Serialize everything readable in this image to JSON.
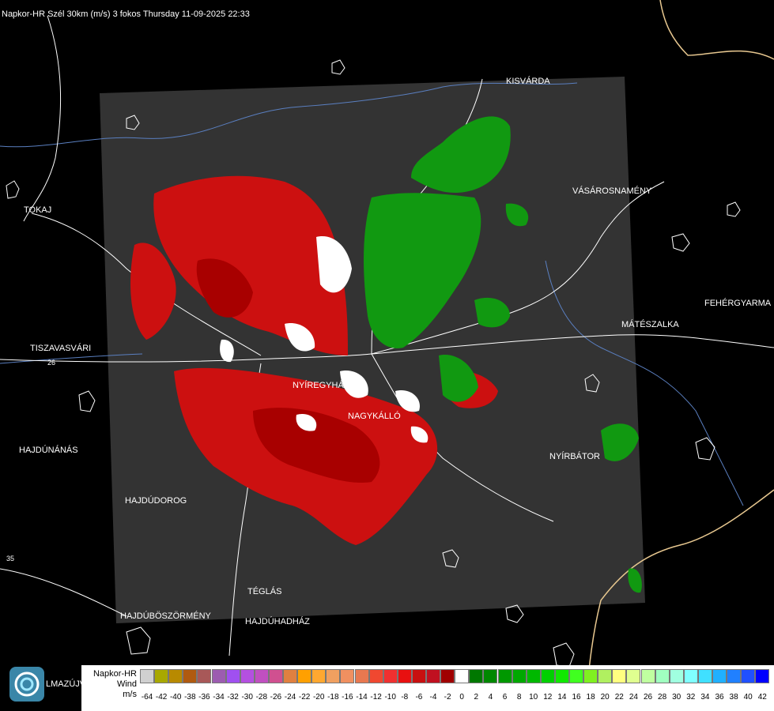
{
  "title": "Napkor-HR Szél 30km (m/s) 3 fokos Thursday 11-09-2025 22:33",
  "cities": [
    {
      "id": "kisvarda",
      "name": "KISVÁRDA"
    },
    {
      "id": "vasarosnameny",
      "name": "VÁSÁROSNAMÉNY"
    },
    {
      "id": "tokaj",
      "name": "TOKAJ"
    },
    {
      "id": "fehergyarmat",
      "name": "FEHÉRGYARMA"
    },
    {
      "id": "mateszalka",
      "name": "MÁTÉSZALKA"
    },
    {
      "id": "tiszavasvari",
      "name": "TISZAVASVÁRI"
    },
    {
      "id": "nyiregyhaza",
      "name": "NYÍREGYHÁZA"
    },
    {
      "id": "nagykallo",
      "name": "NAGYKÁLLÓ"
    },
    {
      "id": "hajdunanas",
      "name": "HAJDÚNÁNÁS"
    },
    {
      "id": "nyirbator",
      "name": "NYÍRBÁTOR"
    },
    {
      "id": "hajdudorog",
      "name": "HAJDÚDOROG"
    },
    {
      "id": "teglas",
      "name": "TÉGLÁS"
    },
    {
      "id": "hajduboszormeny",
      "name": "HAJDÚBÖSZÖRMÉNY"
    },
    {
      "id": "hajduhadhaz",
      "name": "HAJDÚHADHÁZ"
    }
  ],
  "road_labels": [
    "26",
    "35"
  ],
  "logo_text": "LMAZÚJVÁR",
  "legend": {
    "name_line1": "Napkor-HR",
    "name_line2": "Wind",
    "unit": "m/s",
    "ticks": [
      "-64",
      "-42",
      "-40",
      "-38",
      "-36",
      "-34",
      "-32",
      "-30",
      "-28",
      "-26",
      "-24",
      "-22",
      "-20",
      "-18",
      "-16",
      "-14",
      "-12",
      "-10",
      "-8",
      "-6",
      "-4",
      "-2",
      "0",
      "2",
      "4",
      "6",
      "8",
      "10",
      "12",
      "14",
      "16",
      "18",
      "20",
      "22",
      "24",
      "26",
      "28",
      "30",
      "32",
      "34",
      "36",
      "38",
      "40",
      "42"
    ],
    "colors": [
      "#d0d0d0",
      "#a8a800",
      "#b88a00",
      "#b05a10",
      "#a85858",
      "#9c5cb0",
      "#a050f0",
      "#b450e0",
      "#c050c0",
      "#d05090",
      "#e08040",
      "#ffa000",
      "#ffa830",
      "#f0a060",
      "#f09060",
      "#e87850",
      "#f04830",
      "#f03030",
      "#e81010",
      "#c81010",
      "#c01020",
      "#a00000",
      "#ffffff",
      "#007800",
      "#008800",
      "#009800",
      "#00a800",
      "#00b800",
      "#00d000",
      "#10e800",
      "#40ff20",
      "#80f020",
      "#b0f060",
      "#ffff80",
      "#e0ff90",
      "#c0ffa0",
      "#a0ffc0",
      "#a0ffe0",
      "#80ffff",
      "#40e0ff",
      "#20b0ff",
      "#2080ff",
      "#2050ff",
      "#0000ff"
    ]
  }
}
